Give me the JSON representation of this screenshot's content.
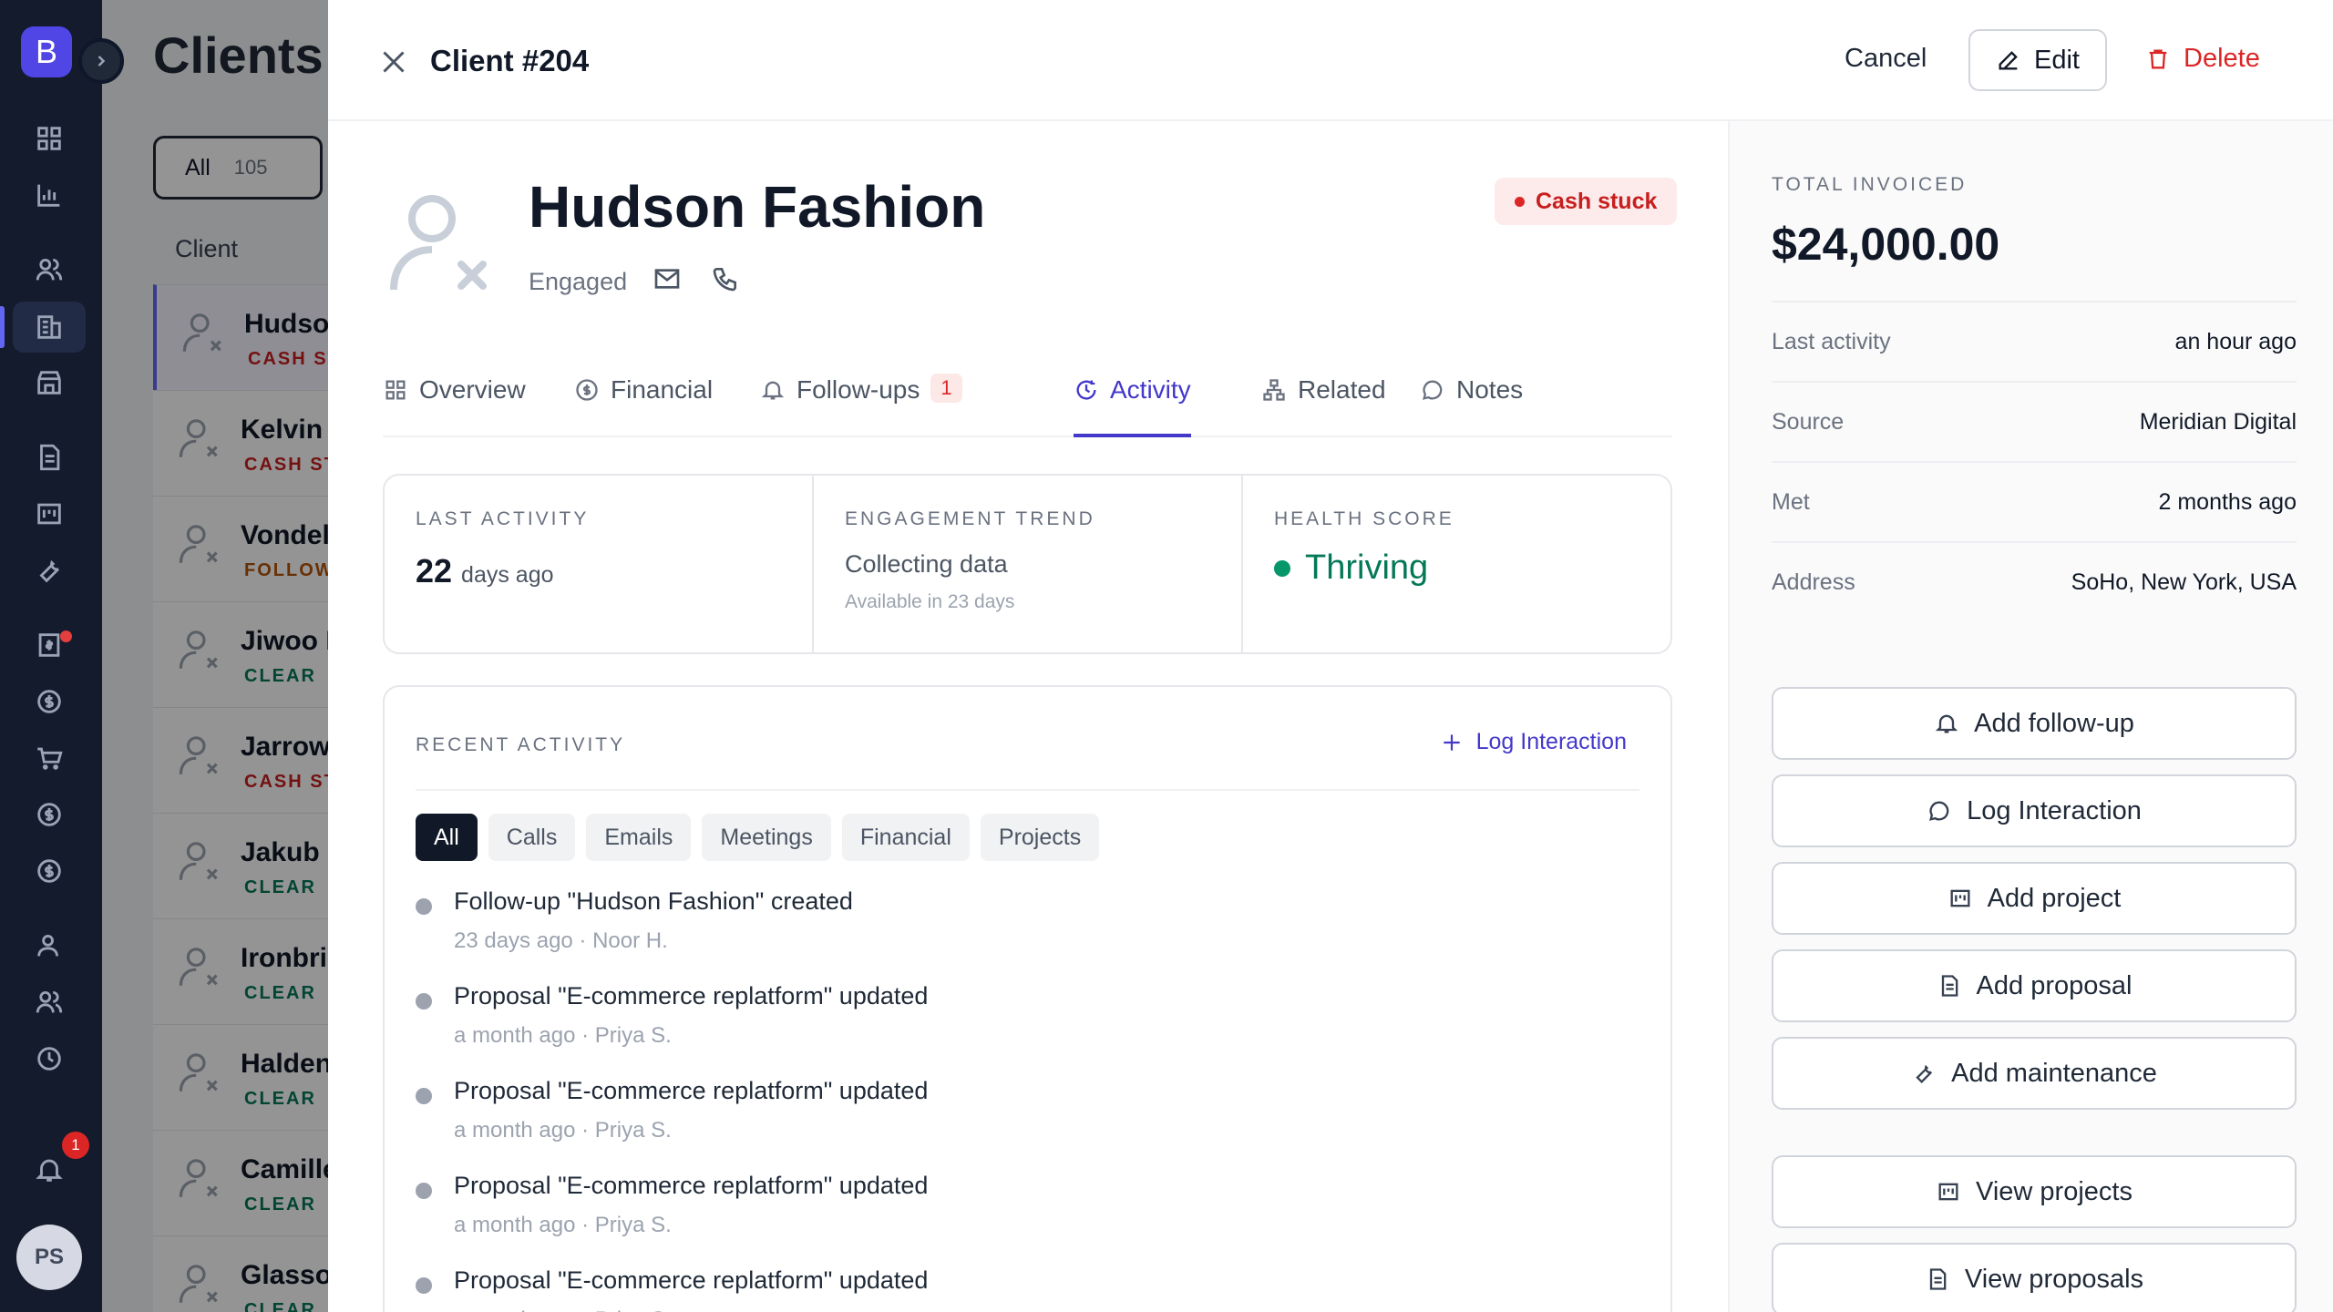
{
  "sidebar": {
    "logo": "B",
    "notification_count": "1",
    "user_initials": "PS"
  },
  "background_list": {
    "title": "Clients",
    "filter": {
      "label": "All",
      "count": "105"
    },
    "column_header": "Client",
    "rows": [
      {
        "name": "Hudsor",
        "status": "CASH ST",
        "color": "#c81e1e"
      },
      {
        "name": "Kelvin S",
        "status": "CASH ST",
        "color": "#c81e1e"
      },
      {
        "name": "Vondel",
        "status": "FOLLOW",
        "color": "#b45309"
      },
      {
        "name": "Jiwoo P",
        "status": "CLEAR",
        "color": "#047857"
      },
      {
        "name": "Jarrow",
        "status": "CASH ST",
        "color": "#c81e1e"
      },
      {
        "name": "Jakub D",
        "status": "CLEAR",
        "color": "#047857"
      },
      {
        "name": "Ironbric",
        "status": "CLEAR",
        "color": "#047857"
      },
      {
        "name": "Halden",
        "status": "CLEAR",
        "color": "#047857"
      },
      {
        "name": "Camille",
        "status": "CLEAR",
        "color": "#047857"
      },
      {
        "name": "Glasso",
        "status": "CLEAR",
        "color": "#047857"
      }
    ]
  },
  "panel": {
    "title": "Client #204",
    "cancel_label": "Cancel",
    "edit_label": "Edit",
    "delete_label": "Delete",
    "client_name": "Hudson Fashion",
    "client_status": "Engaged",
    "status_pill": "Cash stuck",
    "tabs": {
      "overview": "Overview",
      "financial": "Financial",
      "followups": "Follow-ups",
      "followups_badge": "1",
      "activity": "Activity",
      "related": "Related",
      "notes": "Notes"
    },
    "stats": {
      "last_activity_label": "LAST ACTIVITY",
      "last_activity_value": "22",
      "last_activity_unit": "days ago",
      "trend_label": "ENGAGEMENT TREND",
      "trend_value": "Collecting data",
      "trend_sub": "Available in 23 days",
      "health_label": "HEALTH SCORE",
      "health_value": "Thriving"
    },
    "recent": {
      "label": "RECENT ACTIVITY",
      "log_label": "Log Interaction",
      "filters": [
        "All",
        "Calls",
        "Emails",
        "Meetings",
        "Financial",
        "Projects"
      ],
      "items": [
        {
          "title": "Follow-up \"Hudson Fashion\" created",
          "meta": "23 days ago · Noor H."
        },
        {
          "title": "Proposal \"E-commerce replatform\" updated",
          "meta": "a month ago · Priya S."
        },
        {
          "title": "Proposal \"E-commerce replatform\" updated",
          "meta": "a month ago · Priya S."
        },
        {
          "title": "Proposal \"E-commerce replatform\" updated",
          "meta": "a month ago · Priya S."
        },
        {
          "title": "Proposal \"E-commerce replatform\" updated",
          "meta": "a month ago · Priya S."
        }
      ]
    },
    "summary": {
      "total_label": "TOTAL INVOICED",
      "total_value": "$24,000.00",
      "details": [
        {
          "k": "Last activity",
          "v": "an hour ago"
        },
        {
          "k": "Source",
          "v": "Meridian Digital"
        },
        {
          "k": "Met",
          "v": "2 months ago"
        },
        {
          "k": "Address",
          "v": "SoHo, New York, USA"
        }
      ],
      "actions": {
        "add_followup": "Add follow-up",
        "log_interaction": "Log Interaction",
        "add_project": "Add project",
        "add_proposal": "Add proposal",
        "add_maintenance": "Add maintenance",
        "view_projects": "View projects",
        "view_proposals": "View proposals"
      }
    }
  }
}
